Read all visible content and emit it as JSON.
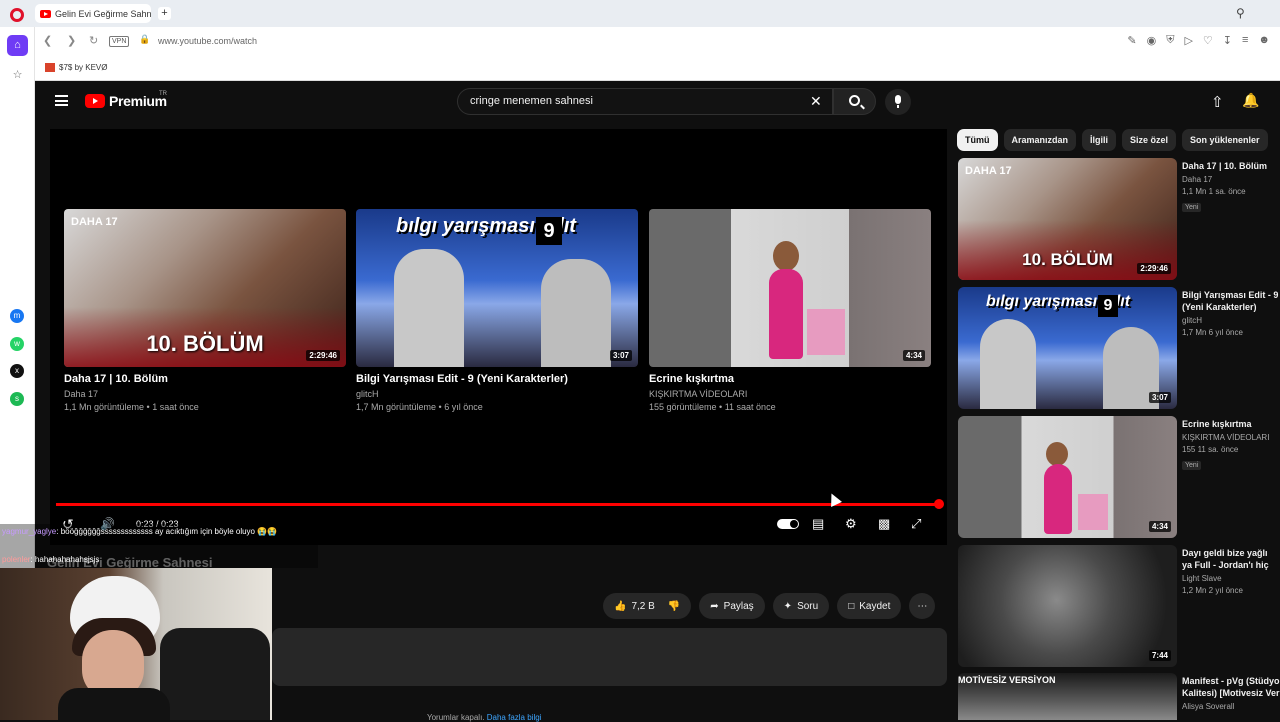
{
  "browser": {
    "tab_title": "Gelin Evi Geğirme Sahnesi",
    "new_tab": "+",
    "vpn": "VPN",
    "url": "www.youtube.com/watch",
    "bookmark": "$7$ by KEVØ"
  },
  "header": {
    "logo_text": "Premium",
    "region": "TR",
    "search_value": "cringe menemen sahnesi"
  },
  "end_screen": [
    {
      "title": "Daha 17 | 10. Bölüm",
      "channel": "Daha 17",
      "meta": "1,1 Mn görüntüleme • 1 saat önce",
      "duration": "2:29:46",
      "overlay": "10. BÖLÜM",
      "brand": "DAHA 17"
    },
    {
      "title": "Bilgi Yarışması Edit - 9 (Yeni Karakterler)",
      "channel": "glitcH",
      "meta": "1,7 Mn görüntüleme • 6 yıl önce",
      "duration": "3:07",
      "overlay": "bılgı yarışması edıt",
      "number": "9"
    },
    {
      "title": "Ecrine kışkırtma",
      "channel": "KIŞKIRTMA VİDEOLARI",
      "meta": "155 görüntüleme • 11 saat önce",
      "duration": "4:34"
    }
  ],
  "player": {
    "time": "0:23 / 0:23",
    "progress": 1.0
  },
  "video": {
    "title": "Gelin Evi Geğirme Sahnesi",
    "likes": "7,2 B",
    "share": "Paylaş",
    "ask": "Soru",
    "save": "Kaydet",
    "comments_prefix": "Yorumlar kapalı.",
    "comments_link": "Daha fazla bilgi"
  },
  "chips": [
    "Tümü",
    "Aramanızdan",
    "İlgili",
    "Size özel",
    "Son yüklenenler"
  ],
  "recommendations": [
    {
      "title": "Daha 17 | 10. Bölüm",
      "channel": "Daha 17",
      "meta": "1,1 Mn  1 sa. önce",
      "badge": "Yeni",
      "duration": "2:29:46"
    },
    {
      "title": "Bilgi Yarışması Edit - 9 (Yeni Karakterler)",
      "channel": "glitcH",
      "meta": "1,7 Mn  6 yıl önce",
      "duration": "3:07"
    },
    {
      "title": "Ecrine kışkırtma",
      "channel": "KIŞKIRTMA VİDEOLARI",
      "meta": "155  11 sa. önce",
      "badge": "Yeni",
      "duration": "4:34"
    },
    {
      "title": "Dayı geldi bize yağlı ya Full - Jordan'ı hiç sevm",
      "channel": "Light Slave",
      "meta": "1,2 Mn  2 yıl önce",
      "duration": "7:44"
    },
    {
      "title": "Manifest - pVg (Stüdyo Kalitesi) [Motivesiz Ver",
      "channel": "Alisya Soverall",
      "meta": "",
      "thumb_text": "MOTİVESİZ VERSİYON"
    }
  ],
  "chat": [
    {
      "user": "yagmur_yaglye",
      "text": ": bööğğğğğğsssssssssssss ay acıktığım için böyle oluyo 😭😭"
    },
    {
      "user": "polenler",
      "text": ": hahahahahahsjsjs"
    }
  ],
  "colors": {
    "accent": "#ff0000",
    "background": "#0f0f0f",
    "link": "#3ea6ff"
  }
}
